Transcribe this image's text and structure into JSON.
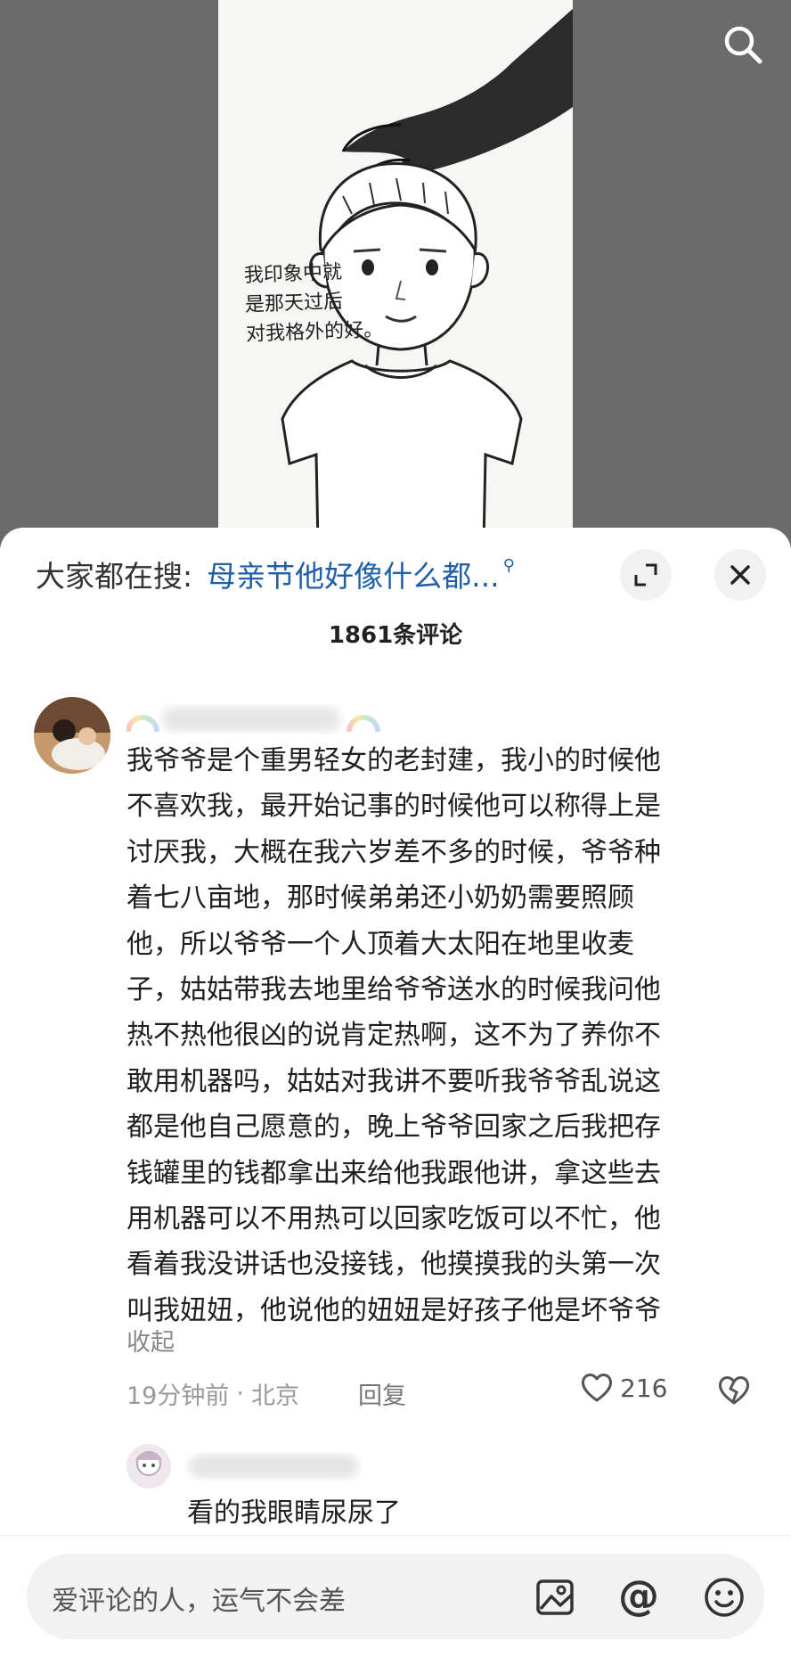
{
  "video": {
    "caption_lines": [
      "我印象中就",
      "是那天过后",
      "对我格外的好。"
    ],
    "search_icon": "search-icon"
  },
  "sheet": {
    "hot_search_label": "大家都在搜:",
    "hot_search_query": "母亲节他好像什么都...",
    "hot_search_icon": "search-small-icon",
    "comment_count": "1861条评论"
  },
  "comment": {
    "text_lines": [
      "我爷爷是个重男轻女的老封建，我小的时候他",
      "不喜欢我，最开始记事的时候他可以称得上是",
      "讨厌我，大概在我六岁差不多的时候，爷爷种",
      "着七八亩地，那时候弟弟还小奶奶需要照顾",
      "他，所以爷爷一个人顶着大太阳在地里收麦",
      "子，姑姑带我去地里给爷爷送水的时候我问他",
      "热不热他很凶的说肯定热啊，这不为了养你不",
      "敢用机器吗，姑姑对我讲不要听我爷爷乱说这",
      "都是他自己愿意的，晚上爷爷回家之后我把存",
      "钱罐里的钱都拿出来给他我跟他讲，拿这些去",
      "用机器可以不用热可以回家吃饭可以不忙，他",
      "看着我没讲话也没接钱，他摸摸我的头第一次",
      "叫我妞妞，他说他的妞妞是好孩子他是坏爷爷"
    ],
    "collapse_label": "收起",
    "time": "19分钟前",
    "separator": "·",
    "location": "北京",
    "reply_label": "回复",
    "like_count": "216"
  },
  "reply_comment": {
    "text": "看的我眼睛尿尿了"
  },
  "input": {
    "placeholder": "爱评论的人，运气不会差",
    "at_symbol": "@"
  }
}
